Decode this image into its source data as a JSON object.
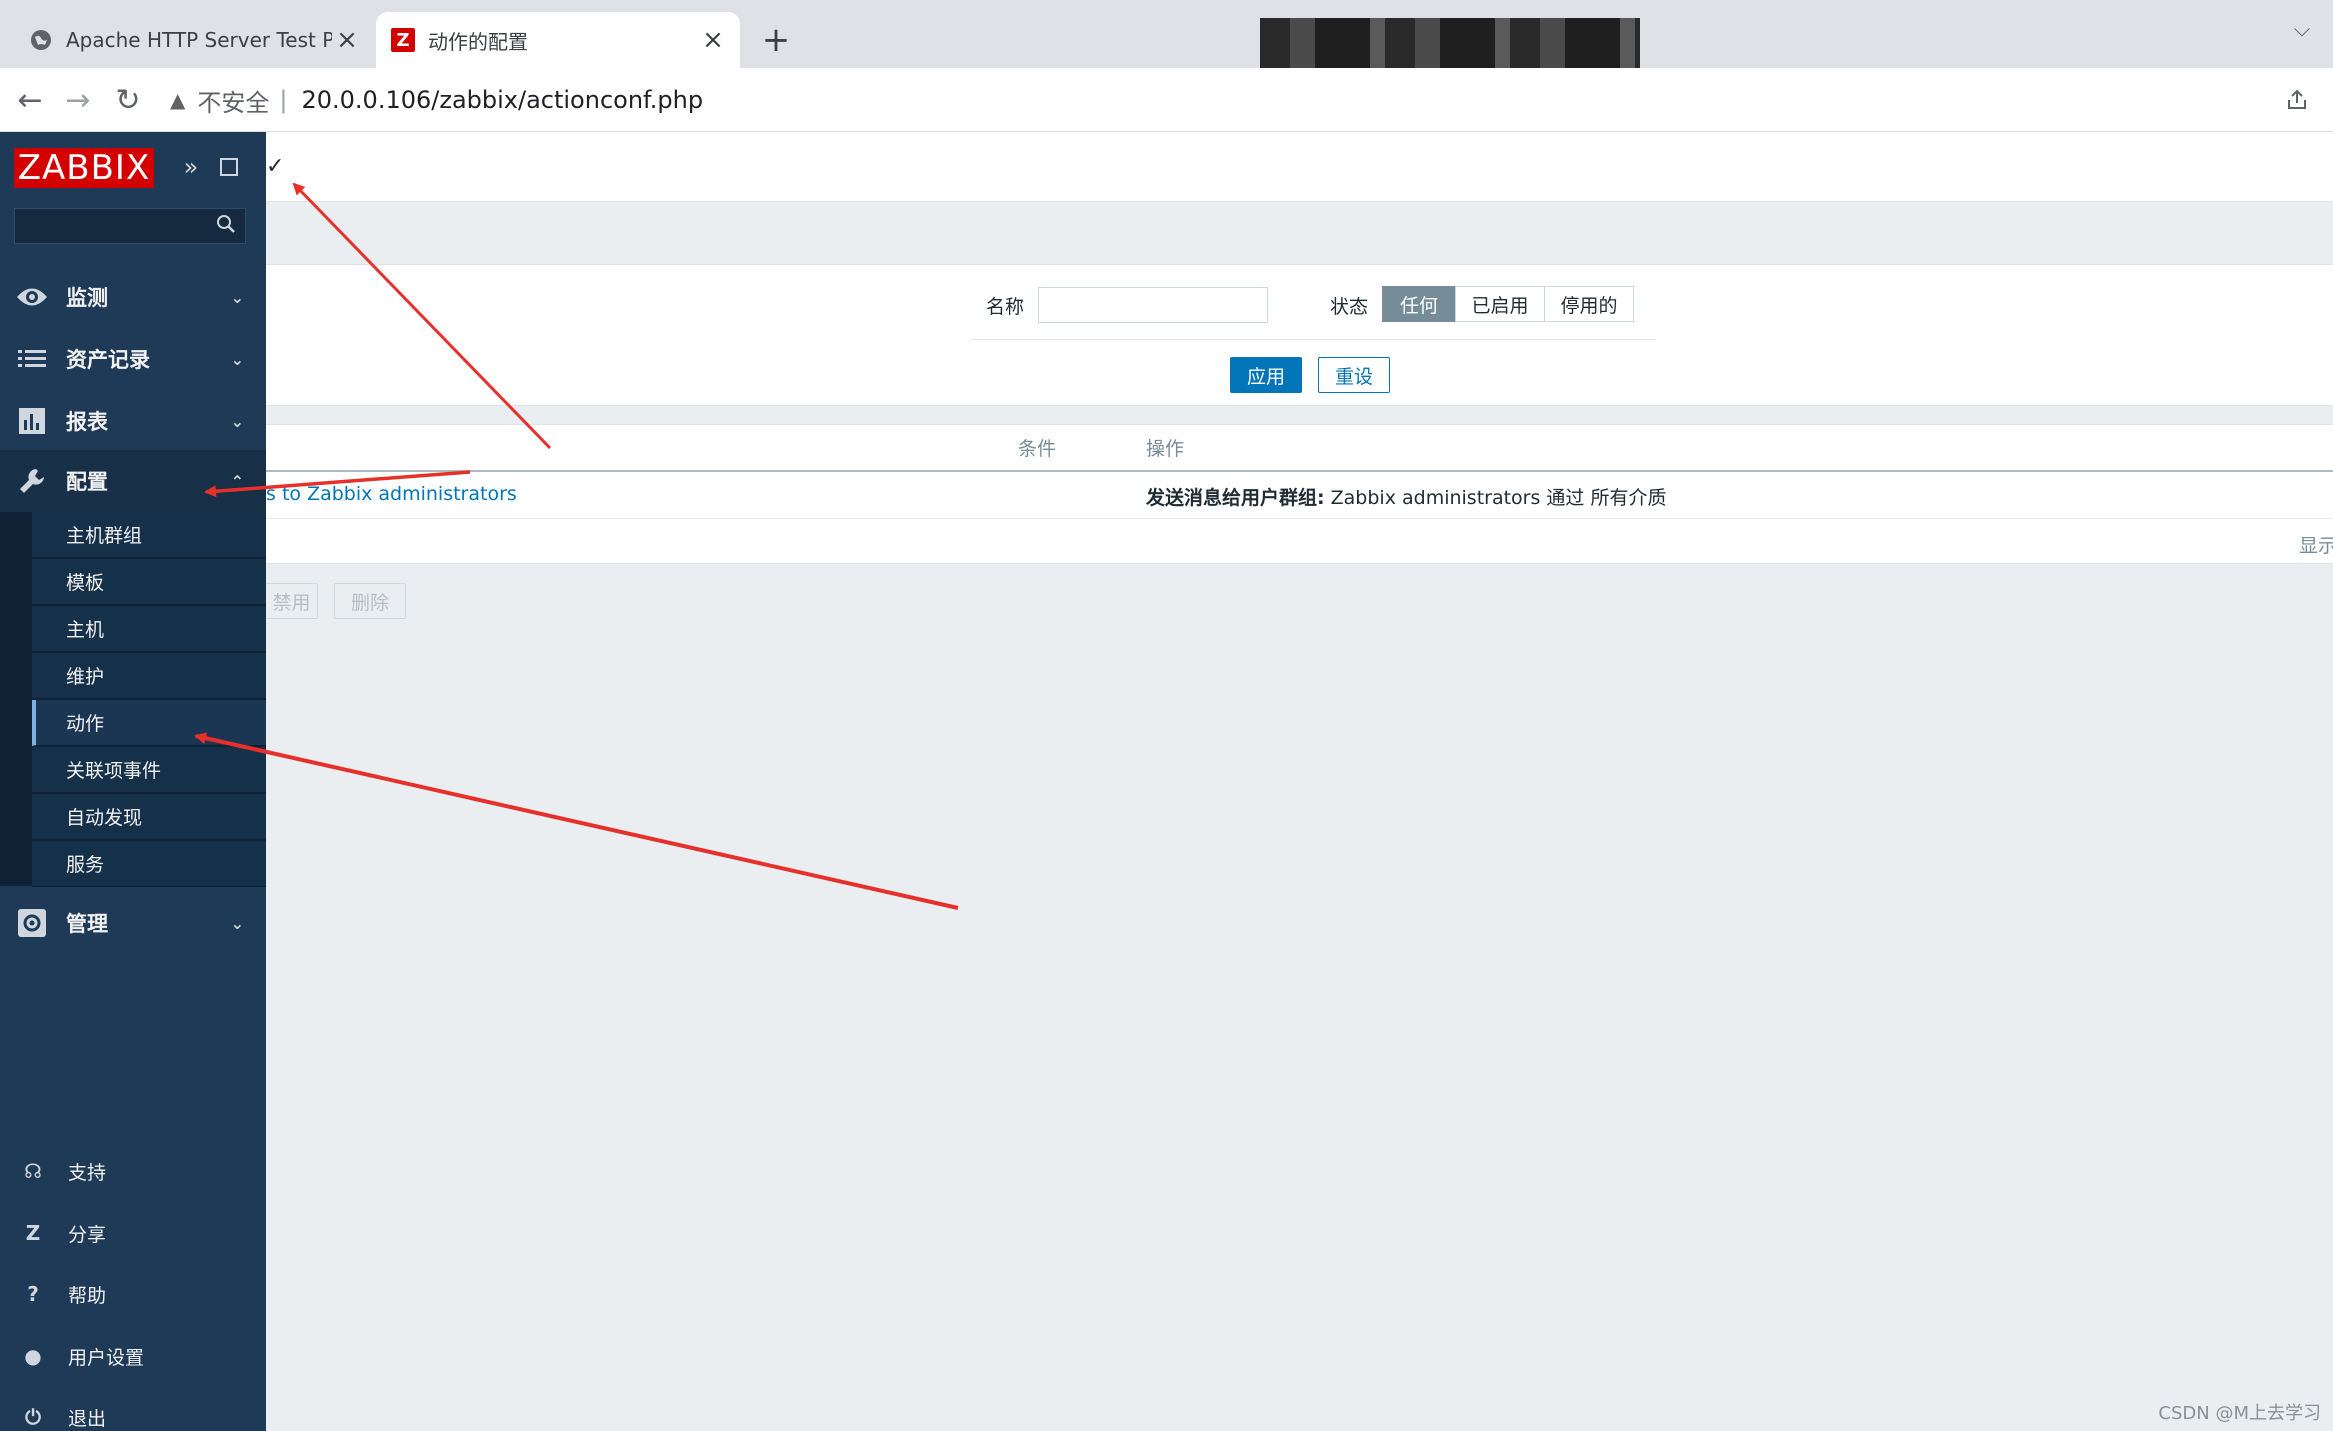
{
  "browser": {
    "tabs": [
      {
        "title": "Apache HTTP Server Test Page",
        "close": "×",
        "icon": "globe-icon"
      },
      {
        "title": "动作的配置",
        "close": "×",
        "icon": "zabbix-favicon",
        "favicon_letter": "Z"
      }
    ],
    "new_tab": "+",
    "tab_dropdown": "⌵",
    "nav": {
      "back": "←",
      "forward": "→",
      "reload": "↻"
    },
    "address": {
      "security_label": "不安全",
      "separator": "|",
      "url": "20.0.0.106/zabbix/actionconf.php",
      "warn": "▲"
    }
  },
  "sidebar": {
    "logo": "ZABBIX",
    "collapse": "»",
    "search_icon": "⚲",
    "menu": [
      {
        "label": "监测",
        "icon": "eye-icon",
        "chevron": "⌄"
      },
      {
        "label": "资产记录",
        "icon": "list-icon",
        "chevron": "⌄"
      },
      {
        "label": "报表",
        "icon": "bar-chart-icon",
        "chevron": "⌄"
      },
      {
        "label": "配置",
        "icon": "wrench-icon",
        "chevron": "⌃"
      },
      {
        "label": "管理",
        "icon": "gear-icon",
        "chevron": "⌄"
      }
    ],
    "submenu": [
      "主机群组",
      "模板",
      "主机",
      "维护",
      "动作",
      "关联项事件",
      "自动发现",
      "服务"
    ],
    "footer": [
      {
        "label": "支持",
        "icon": "headset-icon",
        "glyph": "☊"
      },
      {
        "label": "分享",
        "icon": "share-z-icon",
        "glyph": "Z"
      },
      {
        "label": "帮助",
        "icon": "help-icon",
        "glyph": "?"
      },
      {
        "label": "用户设置",
        "icon": "user-icon",
        "glyph": "●"
      },
      {
        "label": "退出",
        "icon": "power-icon",
        "glyph": "⏻"
      }
    ]
  },
  "main": {
    "title_glyph": "✓",
    "filter": {
      "name_label": "名称",
      "name_value": "",
      "status_label": "状态",
      "status_options": [
        "任何",
        "已启用",
        "停用的"
      ],
      "status_selected": "任何",
      "apply": "应用",
      "reset": "重设"
    },
    "table": {
      "headers": {
        "conditions": "条件",
        "operations": "操作"
      },
      "row": {
        "name": "s to Zabbix administrators",
        "operation_bold": "发送消息给用户群组:",
        "operation_text": " Zabbix administrators 通过 所有介质"
      },
      "display_text": "显示"
    },
    "mass_buttons": [
      "禁用",
      "删除"
    ]
  },
  "watermark": "CSDN @M上去学习",
  "colors": {
    "sidebar": "#1f3a57",
    "logo": "#d40000",
    "accent": "#0275b8",
    "arrow": "#e8302a"
  }
}
